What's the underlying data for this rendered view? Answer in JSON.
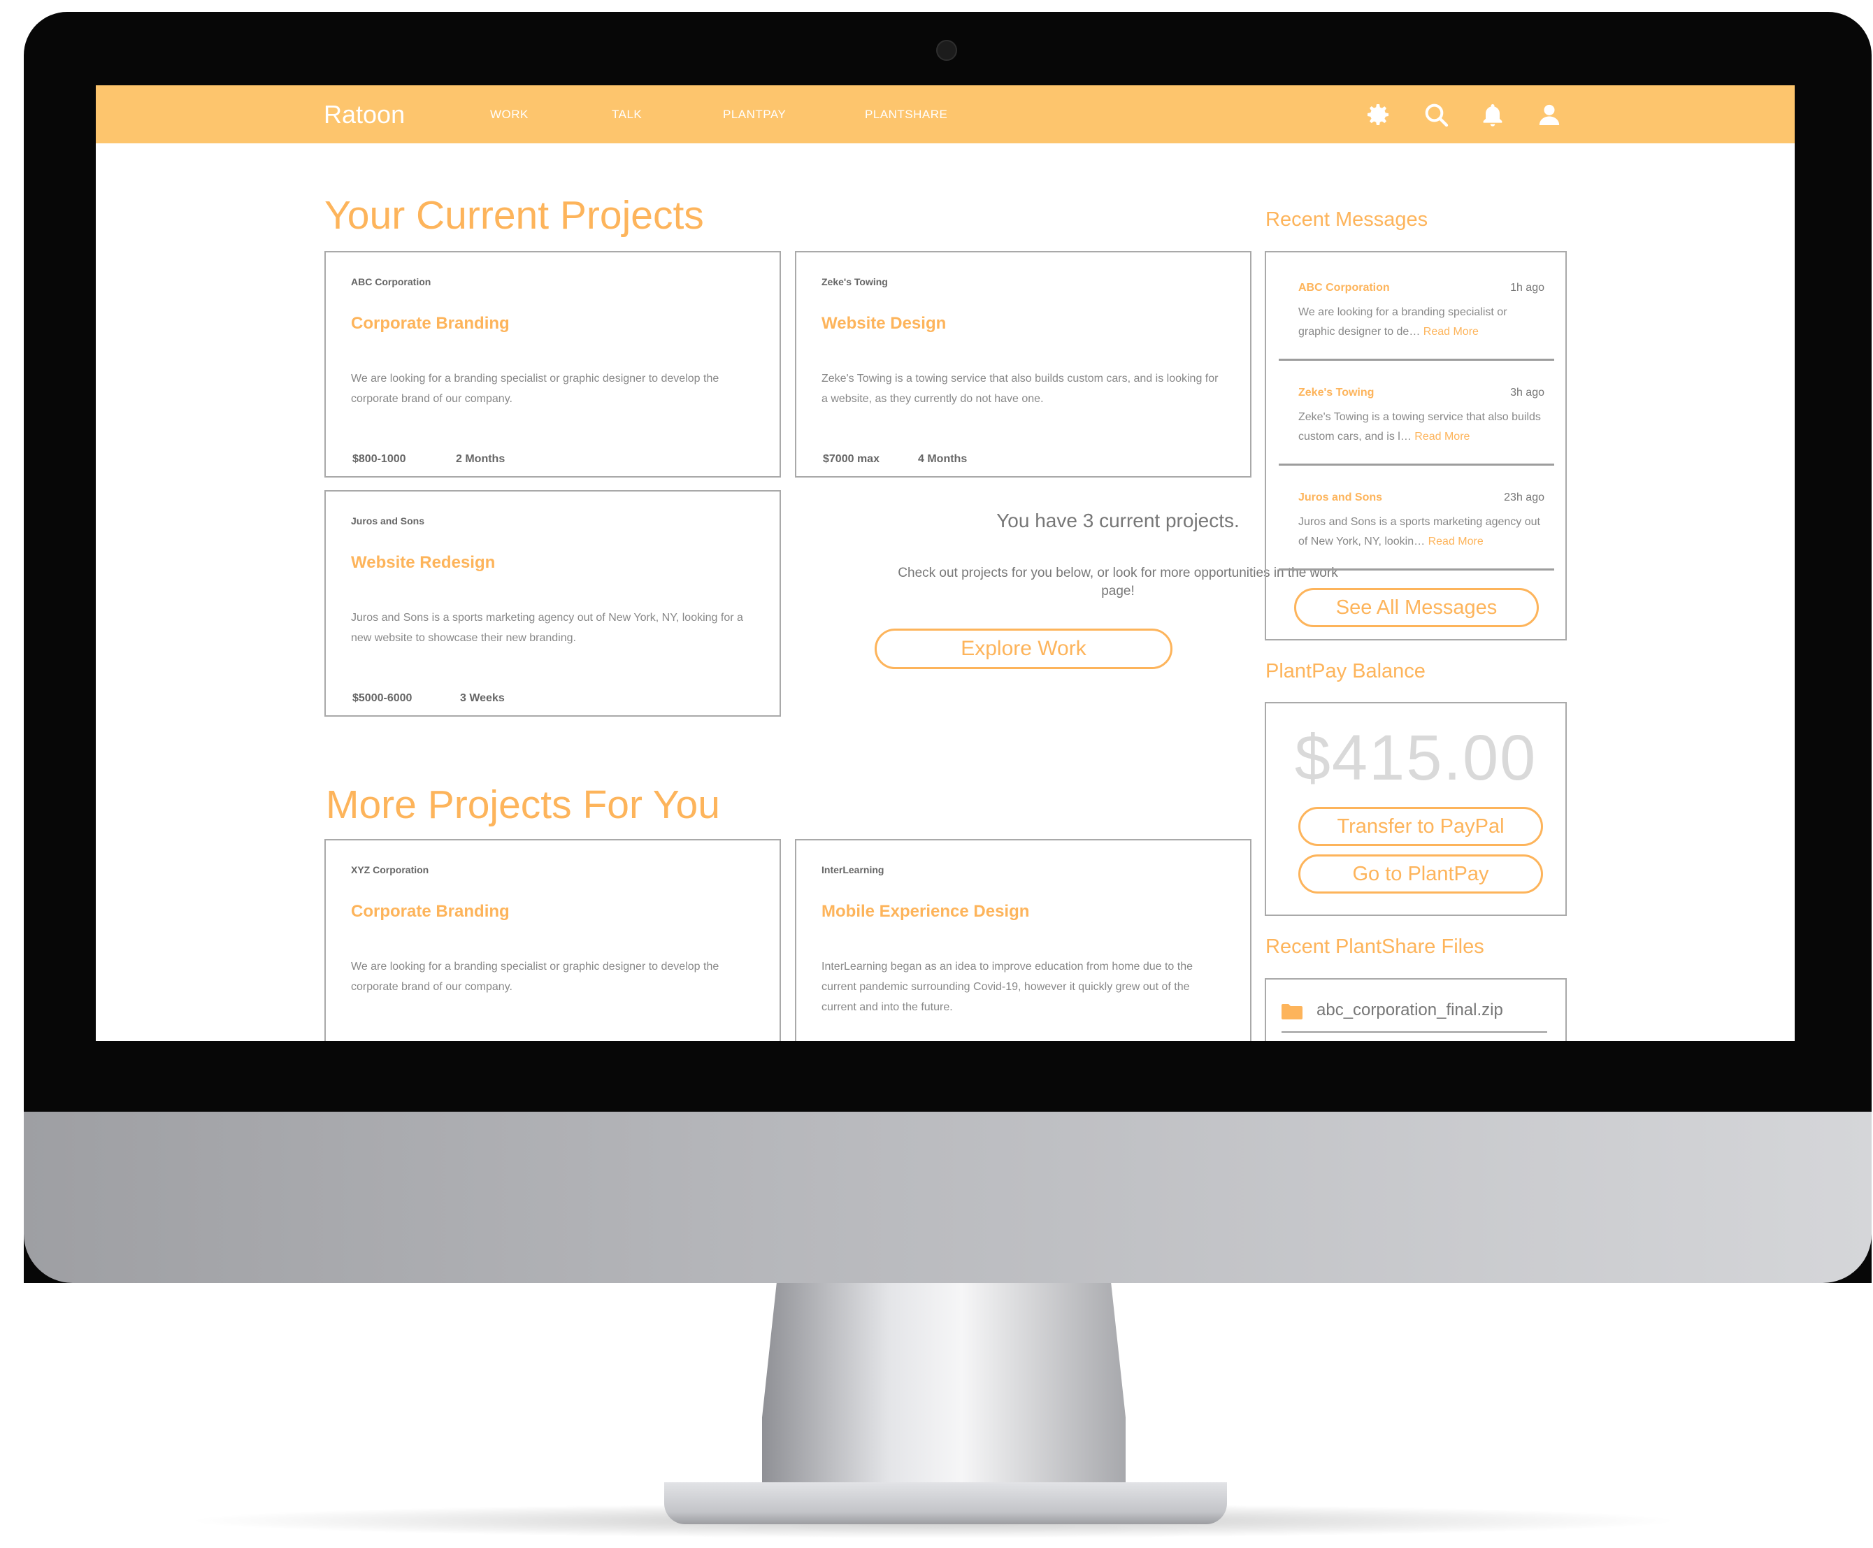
{
  "app": {
    "brand": "Ratoon",
    "nav": [
      "WORK",
      "TALK",
      "PLANTPAY",
      "PLANTSHARE"
    ],
    "accent_color": "#fdc56d",
    "icons": [
      "gear-icon",
      "search-icon",
      "bell-icon",
      "user-icon"
    ]
  },
  "current": {
    "title": "Your Current Projects",
    "projects": [
      {
        "company": "ABC Corporation",
        "title": "Corporate Branding",
        "description": "We are looking for a branding specialist or graphic designer to develop the corporate brand of our company.",
        "budget": "$800-1000",
        "duration": "2 Months"
      },
      {
        "company": "Zeke's Towing",
        "title": "Website Design",
        "description": "Zeke's Towing is a towing service that also builds custom cars, and is looking for a website, as they currently do not have one.",
        "budget": "$7000 max",
        "duration": "4 Months"
      },
      {
        "company": "Juros and Sons",
        "title": "Website Redesign",
        "description": "Juros and Sons is a sports marketing agency out of New York, NY, looking for a new website to showcase their new branding.",
        "budget": "$5000-6000",
        "duration": "3 Weeks"
      }
    ],
    "summary": "You have 3 current projects.",
    "summary_sub": "Check out projects for you below, or look for more opportunities in the work page!",
    "explore_label": "Explore Work"
  },
  "more": {
    "title": "More Projects For You",
    "projects": [
      {
        "company": "XYZ Corporation",
        "title": "Corporate Branding",
        "description": "We are looking for a branding specialist or graphic designer to develop the corporate brand of our company."
      },
      {
        "company": "InterLearning",
        "title": "Mobile Experience Design",
        "description": "InterLearning began as an idea to improve education from home due to the current pandemic surrounding Covid-19, however it quickly grew out of the current and into the future."
      }
    ]
  },
  "messages": {
    "title": "Recent Messages",
    "items": [
      {
        "from": "ABC Corporation",
        "time": "1h ago",
        "preview": "We are looking for a branding specialist or graphic designer to de…",
        "read_more": "Read More"
      },
      {
        "from": "Zeke's Towing",
        "time": "3h ago",
        "preview": "Zeke's Towing is a towing service that also builds custom cars, and is l…",
        "read_more": "Read More"
      },
      {
        "from": "Juros and Sons",
        "time": "23h ago",
        "preview": "Juros and Sons is a sports marketing agency out of New York, NY, lookin…",
        "read_more": "Read More"
      }
    ],
    "see_all_label": "See All Messages"
  },
  "plantpay": {
    "title": "PlantPay Balance",
    "balance": "$415.00",
    "transfer_label": "Transfer to PayPal",
    "goto_label": "Go to PlantPay"
  },
  "plantshare": {
    "title": "Recent PlantShare Files",
    "files": [
      "abc_corporation_final.zip"
    ]
  }
}
